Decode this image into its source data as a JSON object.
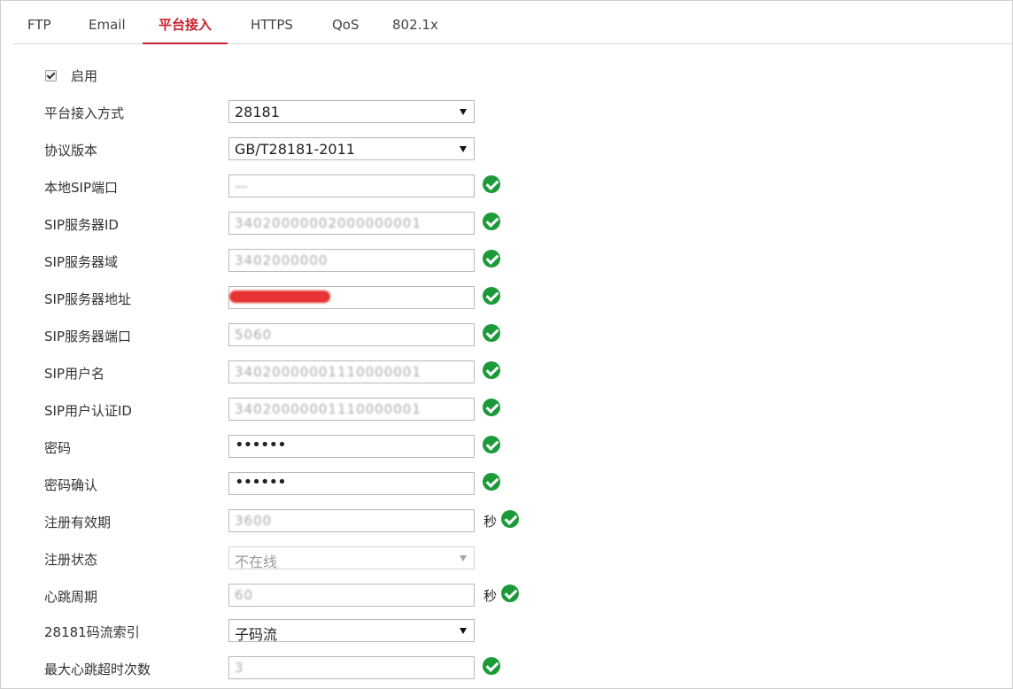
{
  "tabs": [
    "FTP",
    "Email",
    "平台接入",
    "HTTPS",
    "QoS",
    "802.1x"
  ],
  "active_tab": "平台接入",
  "enable": {
    "label": "启用",
    "checked": true
  },
  "form": {
    "access_mode": {
      "label": "平台接入方式",
      "value": "28181"
    },
    "protocol_version": {
      "label": "协议版本",
      "value": "GB/T28181-2011"
    },
    "local_sip_port": {
      "label": "本地SIP端口",
      "value": "—"
    },
    "sip_server_id": {
      "label": "SIP服务器ID",
      "value": "34020000002000000001"
    },
    "sip_server_domain": {
      "label": "SIP服务器域",
      "value": "3402000000"
    },
    "sip_server_address": {
      "label": "SIP服务器地址",
      "value": ""
    },
    "sip_server_port": {
      "label": "SIP服务器端口",
      "value": "5060"
    },
    "sip_username": {
      "label": "SIP用户名",
      "value": "34020000001110000001"
    },
    "sip_auth_id": {
      "label": "SIP用户认证ID",
      "value": "34020000001110000001"
    },
    "password": {
      "label": "密码",
      "value": "••••••"
    },
    "password_confirm": {
      "label": "密码确认",
      "value": "••••••"
    },
    "register_validity": {
      "label": "注册有效期",
      "value": "3600",
      "unit": "秒"
    },
    "register_status": {
      "label": "注册状态",
      "value": "不在线"
    },
    "heartbeat_period": {
      "label": "心跳周期",
      "value": "60",
      "unit": "秒"
    },
    "stream_index": {
      "label": "28181码流索引",
      "value": "子码流"
    },
    "max_heartbeat_timeouts": {
      "label": "最大心跳超时次数",
      "value": "3"
    }
  },
  "colors": {
    "accent": "#c7212e",
    "ok": "#1c9a3a"
  }
}
